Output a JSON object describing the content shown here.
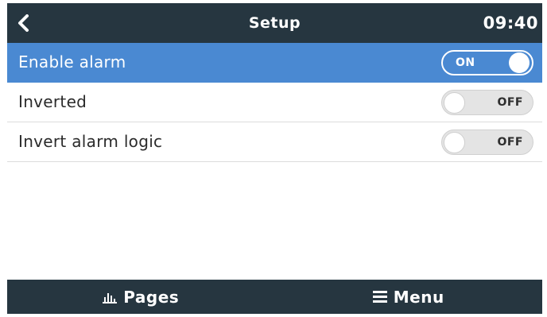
{
  "header": {
    "title": "Setup",
    "time": "09:40"
  },
  "settings": [
    {
      "label": "Enable alarm",
      "state": "ON",
      "selected": true
    },
    {
      "label": "Inverted",
      "state": "OFF",
      "selected": false
    },
    {
      "label": "Invert alarm logic",
      "state": "OFF",
      "selected": false
    }
  ],
  "footer": {
    "pages_label": "Pages",
    "menu_label": "Menu"
  },
  "icons": {
    "back": "chevron-left-icon",
    "pages": "bar-chart-icon",
    "menu": "hamburger-menu-icon"
  },
  "colors": {
    "bar_background": "#263640",
    "selected_row": "#4a89d2"
  }
}
